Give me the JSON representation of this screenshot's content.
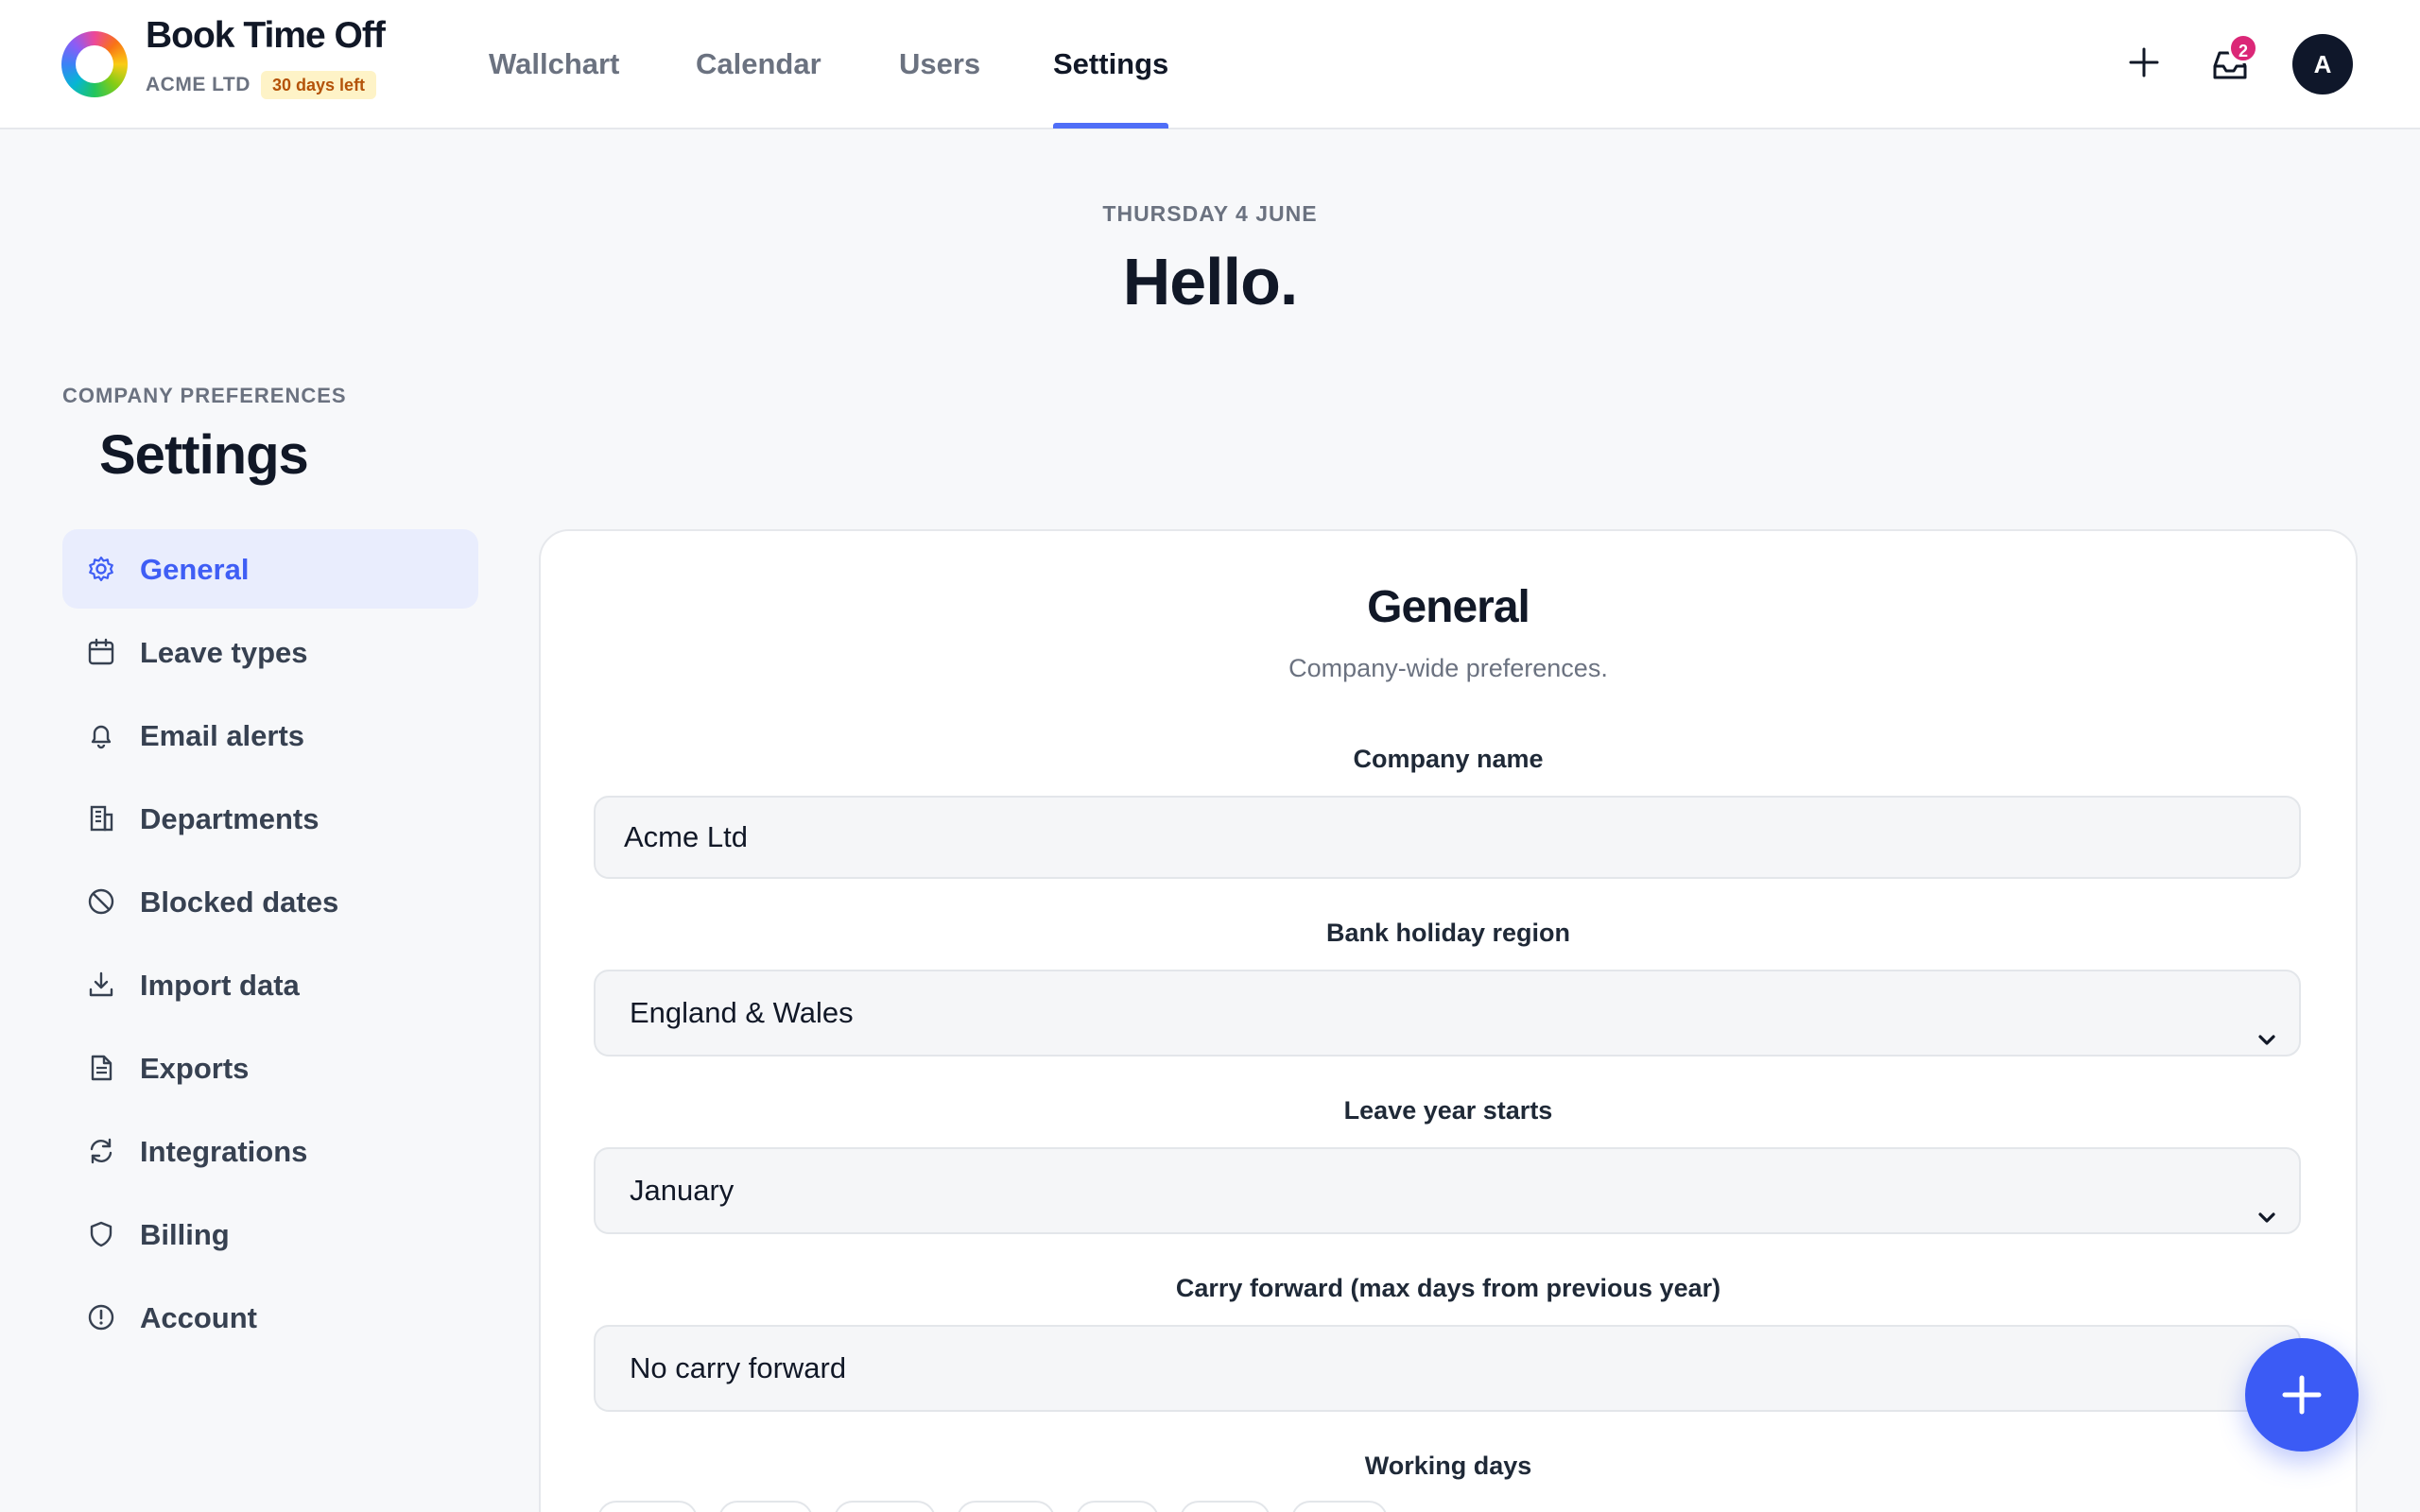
{
  "app": {
    "brand_name": "Book Time Off",
    "company": "ACME LTD",
    "trial_badge": "30 days left"
  },
  "nav": {
    "tabs": [
      {
        "label": "Wallchart",
        "active": false
      },
      {
        "label": "Calendar",
        "active": false
      },
      {
        "label": "Users",
        "active": false
      },
      {
        "label": "Settings",
        "active": true
      }
    ],
    "inbox_count": "2",
    "avatar_initial": "A"
  },
  "greeting": {
    "date": "THURSDAY 4 JUNE",
    "title": "Hello."
  },
  "sidebar": {
    "eyebrow": "COMPANY PREFERENCES",
    "title": "Settings",
    "items": [
      {
        "label": "General",
        "icon": "gear-icon",
        "active": true
      },
      {
        "label": "Leave types",
        "icon": "calendar-icon",
        "active": false
      },
      {
        "label": "Email alerts",
        "icon": "bell-icon",
        "active": false
      },
      {
        "label": "Departments",
        "icon": "building-icon",
        "active": false
      },
      {
        "label": "Blocked dates",
        "icon": "block-icon",
        "active": false
      },
      {
        "label": "Import data",
        "icon": "download-icon",
        "active": false
      },
      {
        "label": "Exports",
        "icon": "document-icon",
        "active": false
      },
      {
        "label": "Integrations",
        "icon": "refresh-icon",
        "active": false
      },
      {
        "label": "Billing",
        "icon": "shield-icon",
        "active": false
      },
      {
        "label": "Account",
        "icon": "alert-circle-icon",
        "active": false
      }
    ]
  },
  "general": {
    "title": "General",
    "subtitle": "Company-wide preferences.",
    "company_name_label": "Company name",
    "company_name_value": "Acme Ltd",
    "bank_holiday_label": "Bank holiday region",
    "bank_holiday_value": "England & Wales",
    "leave_year_label": "Leave year starts",
    "leave_year_value": "January",
    "carry_forward_label": "Carry forward (max days from previous year)",
    "carry_forward_value": "No carry forward",
    "working_days_label": "Working days"
  },
  "colors": {
    "accent": "#3f5ef5",
    "active_bg": "#e9edfd",
    "badge": "#db2777",
    "trial_bg": "#fef3c7",
    "trial_text": "#b45309"
  }
}
